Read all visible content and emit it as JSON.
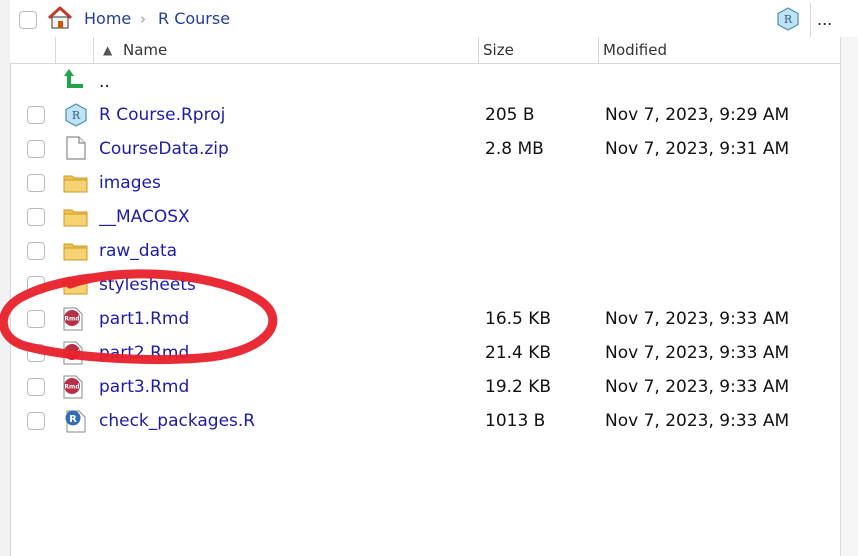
{
  "breadcrumb": {
    "items": [
      "Home",
      "R Course"
    ],
    "separator": "›",
    "more_label": "..."
  },
  "columns": {
    "name": "Name",
    "size": "Size",
    "modified": "Modified",
    "sort_indicator": "▲"
  },
  "parent_row": {
    "label": ".."
  },
  "files": [
    {
      "name": "R Course.Rproj",
      "size": "205 B",
      "modified": "Nov 7, 2023, 9:29 AM",
      "icon": "rproj-icon"
    },
    {
      "name": "CourseData.zip",
      "size": "2.8 MB",
      "modified": "Nov 7, 2023, 9:31 AM",
      "icon": "file-icon"
    },
    {
      "name": "images",
      "size": "",
      "modified": "",
      "icon": "folder-icon"
    },
    {
      "name": "__MACOSX",
      "size": "",
      "modified": "",
      "icon": "folder-icon"
    },
    {
      "name": "raw_data",
      "size": "",
      "modified": "",
      "icon": "folder-icon"
    },
    {
      "name": "stylesheets",
      "size": "",
      "modified": "",
      "icon": "folder-icon"
    },
    {
      "name": "part1.Rmd",
      "size": "16.5 KB",
      "modified": "Nov 7, 2023, 9:33 AM",
      "icon": "rmd-icon"
    },
    {
      "name": "part2.Rmd",
      "size": "21.4 KB",
      "modified": "Nov 7, 2023, 9:33 AM",
      "icon": "rmd-icon"
    },
    {
      "name": "part3.Rmd",
      "size": "19.2 KB",
      "modified": "Nov 7, 2023, 9:33 AM",
      "icon": "rmd-icon"
    },
    {
      "name": "check_packages.R",
      "size": "1013 B",
      "modified": "Nov 7, 2023, 9:33 AM",
      "icon": "r-script-icon"
    }
  ],
  "colors": {
    "link": "#1c1ca6",
    "annotation": "#e8202a",
    "folder": "#f2c14e",
    "rmd": "#b5314a"
  }
}
